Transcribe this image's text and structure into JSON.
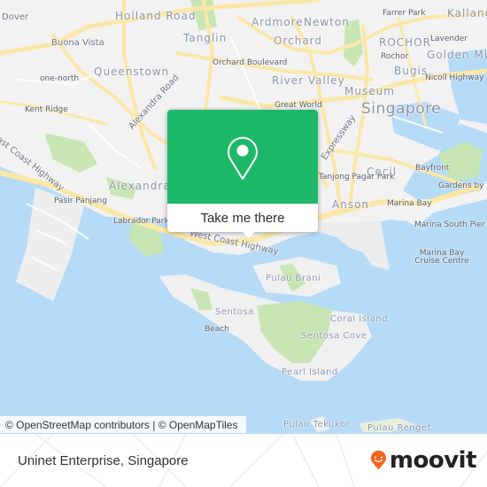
{
  "map": {
    "labels": [
      {
        "text": "Dover",
        "cls": "",
        "id": "dover"
      },
      {
        "text": "Holland Road",
        "cls": "big",
        "id": "holland-road"
      },
      {
        "text": "Ardmore",
        "cls": "big",
        "id": "ardmore"
      },
      {
        "text": "Newton",
        "cls": "big",
        "id": "newton"
      },
      {
        "text": "Farrer Park",
        "cls": "sm",
        "id": "farrer-park"
      },
      {
        "text": "Kallang",
        "cls": "big",
        "id": "kallang"
      },
      {
        "text": "Buona Vista",
        "cls": "",
        "id": "buona-vista"
      },
      {
        "text": "Tanglin",
        "cls": "big",
        "id": "tanglin"
      },
      {
        "text": "Orchard",
        "cls": "big",
        "id": "orchard"
      },
      {
        "text": "ROCHOR",
        "cls": "big",
        "id": "rochor-district"
      },
      {
        "text": "Lavender",
        "cls": "sm",
        "id": "lavender"
      },
      {
        "text": "Queenstown",
        "cls": "big",
        "id": "queenstown"
      },
      {
        "text": "Orchard Boulevard",
        "cls": "sm",
        "id": "orchard-boulevard"
      },
      {
        "text": "Rochor",
        "cls": "sm",
        "id": "rochor"
      },
      {
        "text": "Golden Mile",
        "cls": "big",
        "id": "golden-mile"
      },
      {
        "text": "one-north",
        "cls": "sm",
        "id": "one-north"
      },
      {
        "text": "Bugis",
        "cls": "big",
        "id": "bugis"
      },
      {
        "text": "River Valley",
        "cls": "big",
        "id": "river-valley"
      },
      {
        "text": "Nicoll Highway",
        "cls": "sm",
        "id": "nicoll-highway"
      },
      {
        "text": "Museum",
        "cls": "big",
        "id": "museum"
      },
      {
        "text": "Kent Ridge",
        "cls": "sm",
        "id": "kent-ridge"
      },
      {
        "text": "Great World",
        "cls": "sm",
        "id": "great-world"
      },
      {
        "text": "Singapore",
        "cls": "city",
        "id": "singapore"
      },
      {
        "text": "Alexandra Road",
        "cls": "",
        "id": "alexandra-road"
      },
      {
        "text": "East Coast Highway",
        "cls": "",
        "id": "east-coast-highway-west"
      },
      {
        "text": "Expressway",
        "cls": "",
        "id": "expressway"
      },
      {
        "text": "Cecil",
        "cls": "big",
        "id": "cecil"
      },
      {
        "text": "Bayfront",
        "cls": "sm",
        "id": "bayfront"
      },
      {
        "text": "Tanjong Pagar Park",
        "cls": "sm",
        "id": "tanjong-pagar-park"
      },
      {
        "text": "Alexandra",
        "cls": "big",
        "id": "alexandra"
      },
      {
        "text": "Gardens by the Bay",
        "cls": "sm",
        "id": "gardens-by-the-bay"
      },
      {
        "text": "Pasir Panjang",
        "cls": "sm",
        "id": "pasir-panjang"
      },
      {
        "text": "Anson",
        "cls": "big",
        "id": "anson"
      },
      {
        "text": "Marina Bay",
        "cls": "sm",
        "id": "marina-bay"
      },
      {
        "text": "Labrador Park",
        "cls": "sm",
        "id": "labrador-park"
      },
      {
        "text": "West Coast Highway",
        "cls": "",
        "id": "west-coast-highway"
      },
      {
        "text": "Marina South Pier",
        "cls": "sm",
        "id": "marina-south-pier"
      },
      {
        "text": "Pulau Brani",
        "cls": "sea",
        "id": "pulau-brani"
      },
      {
        "text": "Marina Bay Cruise Centre",
        "cls": "sm",
        "id": "marina-bay-cruise-centre"
      },
      {
        "text": "Sentosa",
        "cls": "sea",
        "id": "sentosa"
      },
      {
        "text": "Coral Island",
        "cls": "sea",
        "id": "coral-island"
      },
      {
        "text": "Beach",
        "cls": "sm",
        "id": "beach"
      },
      {
        "text": "Sentosa Cove",
        "cls": "sea",
        "id": "sentosa-cove"
      },
      {
        "text": "Pearl Island",
        "cls": "sea",
        "id": "pearl-island"
      },
      {
        "text": "Pulau Tekukor",
        "cls": "sea",
        "id": "pulau-tekukor"
      },
      {
        "text": "Pulau Renget",
        "cls": "sea",
        "id": "pulau-renget"
      }
    ],
    "colors": {
      "water": "#b6dbf7",
      "land": "#f2f2f2",
      "park": "#c8e6b4",
      "road": "#fbe7a6",
      "marker_green": "#1db868"
    }
  },
  "popup": {
    "icon": "map-pin-icon",
    "button_label": "Take me there"
  },
  "attribution": "© OpenStreetMap contributors | © OpenMapTiles",
  "footer": {
    "place_name": "Uninet Enterprise, Singapore",
    "brand": "moovit",
    "brand_color": "#f26522"
  }
}
